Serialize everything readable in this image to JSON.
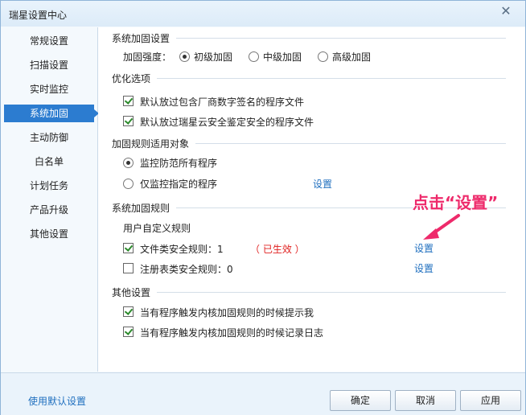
{
  "window": {
    "title": "瑞星设置中心"
  },
  "sidebar": {
    "items": [
      "常规设置",
      "扫描设置",
      "实时监控",
      "系统加固",
      "主动防御",
      "白名单",
      "计划任务",
      "产品升级",
      "其他设置"
    ],
    "active_index": 3
  },
  "reinforce": {
    "title": "系统加固设置",
    "strength_label": "加固强度：",
    "options": [
      "初级加固",
      "中级加固",
      "高级加固"
    ],
    "selected": "初级加固"
  },
  "optimize": {
    "title": "优化选项",
    "items": [
      {
        "label": "默认放过包含厂商数字签名的程序文件",
        "checked": true
      },
      {
        "label": "默认放过瑞星云安全鉴定安全的程序文件",
        "checked": true
      }
    ]
  },
  "target": {
    "title": "加固规则适用对象",
    "options": [
      "监控防范所有程序",
      "仅监控指定的程序"
    ],
    "selected": "监控防范所有程序",
    "settings_link": "设置"
  },
  "rules": {
    "title": "系统加固规则",
    "subtitle": "用户自定义规则",
    "items": [
      {
        "label": "文件类安全规则：1",
        "checked": true,
        "status": "（ 已生效 ）",
        "link": "设置"
      },
      {
        "label": "注册表类安全规则：0",
        "checked": false,
        "status": "",
        "link": "设置"
      }
    ]
  },
  "other": {
    "title": "其他设置",
    "items": [
      {
        "label": "当有程序触发内核加固规则的时候提示我",
        "checked": true
      },
      {
        "label": "当有程序触发内核加固规则的时候记录日志",
        "checked": true
      }
    ]
  },
  "annotation": {
    "text": "点击“设置”",
    "color": "#ee2a6b"
  },
  "footer": {
    "default_link": "使用默认设置",
    "ok": "确定",
    "cancel": "取消",
    "apply": "应用"
  },
  "colors": {
    "accent": "#2c7cd0",
    "link": "#1f6fbf",
    "status_red": "#e0201f"
  }
}
